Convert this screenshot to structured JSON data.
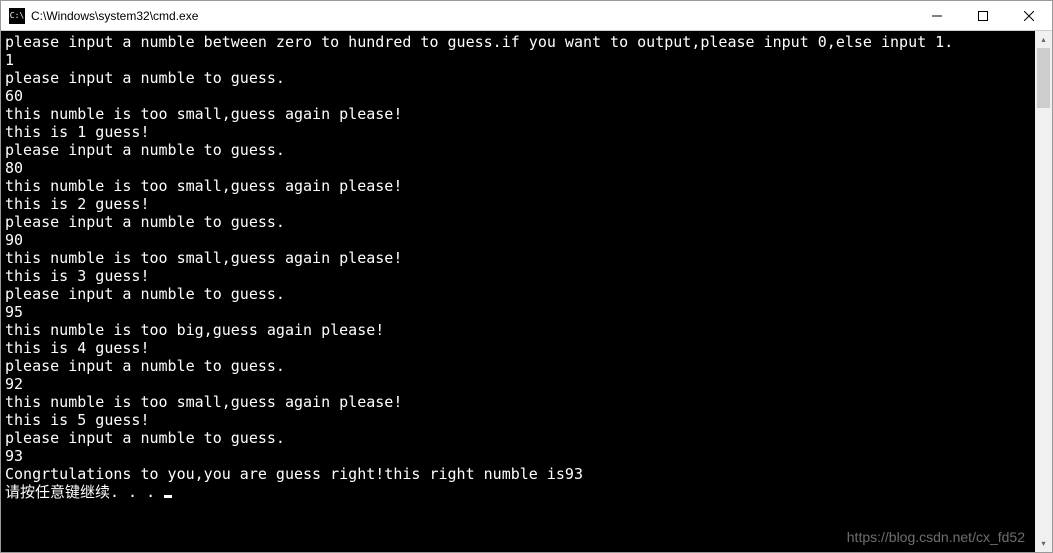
{
  "titlebar": {
    "title": "C:\\Windows\\system32\\cmd.exe",
    "icon_label": "C:\\"
  },
  "console": {
    "lines": [
      "please input a numble between zero to hundred to guess.if you want to output,please input 0,else input 1.",
      "1",
      "please input a numble to guess.",
      "60",
      "this numble is too small,guess again please!",
      "this is 1 guess!",
      "please input a numble to guess.",
      "80",
      "this numble is too small,guess again please!",
      "this is 2 guess!",
      "please input a numble to guess.",
      "90",
      "this numble is too small,guess again please!",
      "this is 3 guess!",
      "please input a numble to guess.",
      "95",
      "this numble is too big,guess again please!",
      "this is 4 guess!",
      "please input a numble to guess.",
      "92",
      "this numble is too small,guess again please!",
      "this is 5 guess!",
      "please input a numble to guess.",
      "93",
      "Congrtulations to you,you are guess right!this right numble is93",
      "请按任意键继续. . . "
    ]
  },
  "watermark": "https://blog.csdn.net/cx_fd52"
}
